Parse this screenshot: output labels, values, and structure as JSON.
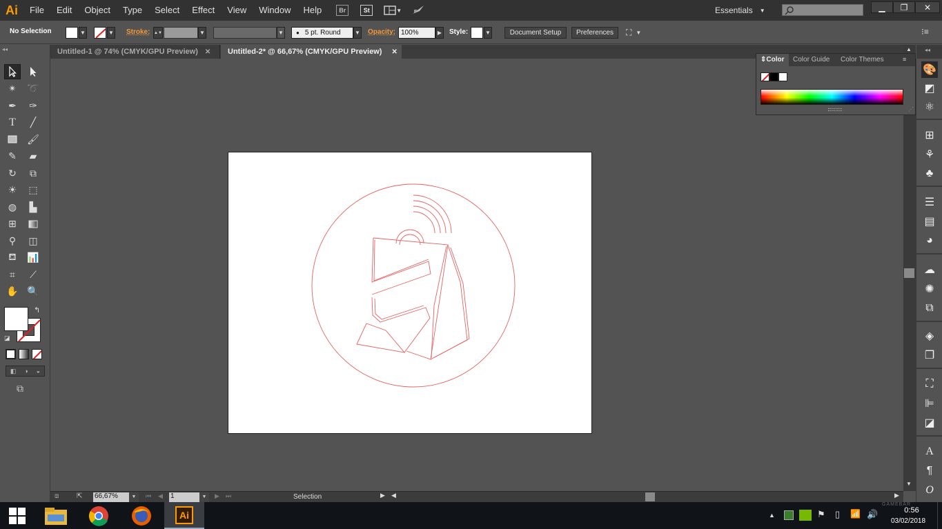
{
  "app": {
    "logo": "Ai",
    "accent": "#ff9a00"
  },
  "menu": [
    "File",
    "Edit",
    "Object",
    "Type",
    "Select",
    "Effect",
    "View",
    "Window",
    "Help"
  ],
  "menubar_buttons": {
    "bridge": "Br",
    "stock": "St"
  },
  "workspace": {
    "label": "Essentials"
  },
  "control": {
    "selection": "No Selection",
    "stroke_label": "Stroke:",
    "brush_label": "5 pt. Round",
    "opacity_label": "Opacity:",
    "opacity_value": "100%",
    "style_label": "Style:",
    "document_setup": "Document Setup",
    "preferences": "Preferences"
  },
  "tabs": [
    {
      "label": "Untitled-1 @ 74% (CMYK/GPU Preview)",
      "active": false
    },
    {
      "label": "Untitled-2* @ 66,67% (CMYK/GPU Preview)",
      "active": true
    }
  ],
  "color_panel": {
    "tabs": [
      "Color",
      "Color Guide",
      "Color Themes"
    ]
  },
  "statusbar": {
    "zoom": "66,67%",
    "artboard": "1",
    "tool": "Selection"
  },
  "taskbar": {
    "time": "0:56",
    "date": "03/02/2018",
    "ai_label": "Ai",
    "watermark": "GAMEBAR"
  },
  "icons": [
    "selection-icon",
    "direct-selection-icon",
    "magic-wand-icon",
    "lasso-icon",
    "pen-icon",
    "curvature-icon",
    "type-icon",
    "line-icon",
    "rectangle-icon",
    "paintbrush-icon",
    "pencil-icon",
    "eraser-icon",
    "rotate-icon",
    "scale-icon",
    "warp-icon",
    "free-transform-icon",
    "shape-builder-icon",
    "perspective-grid-icon",
    "mesh-icon",
    "gradient-icon",
    "eyedropper-icon",
    "blend-icon",
    "symbol-sprayer-icon",
    "column-graph-icon",
    "artboard-icon",
    "slice-icon",
    "hand-icon",
    "zoom-icon"
  ]
}
